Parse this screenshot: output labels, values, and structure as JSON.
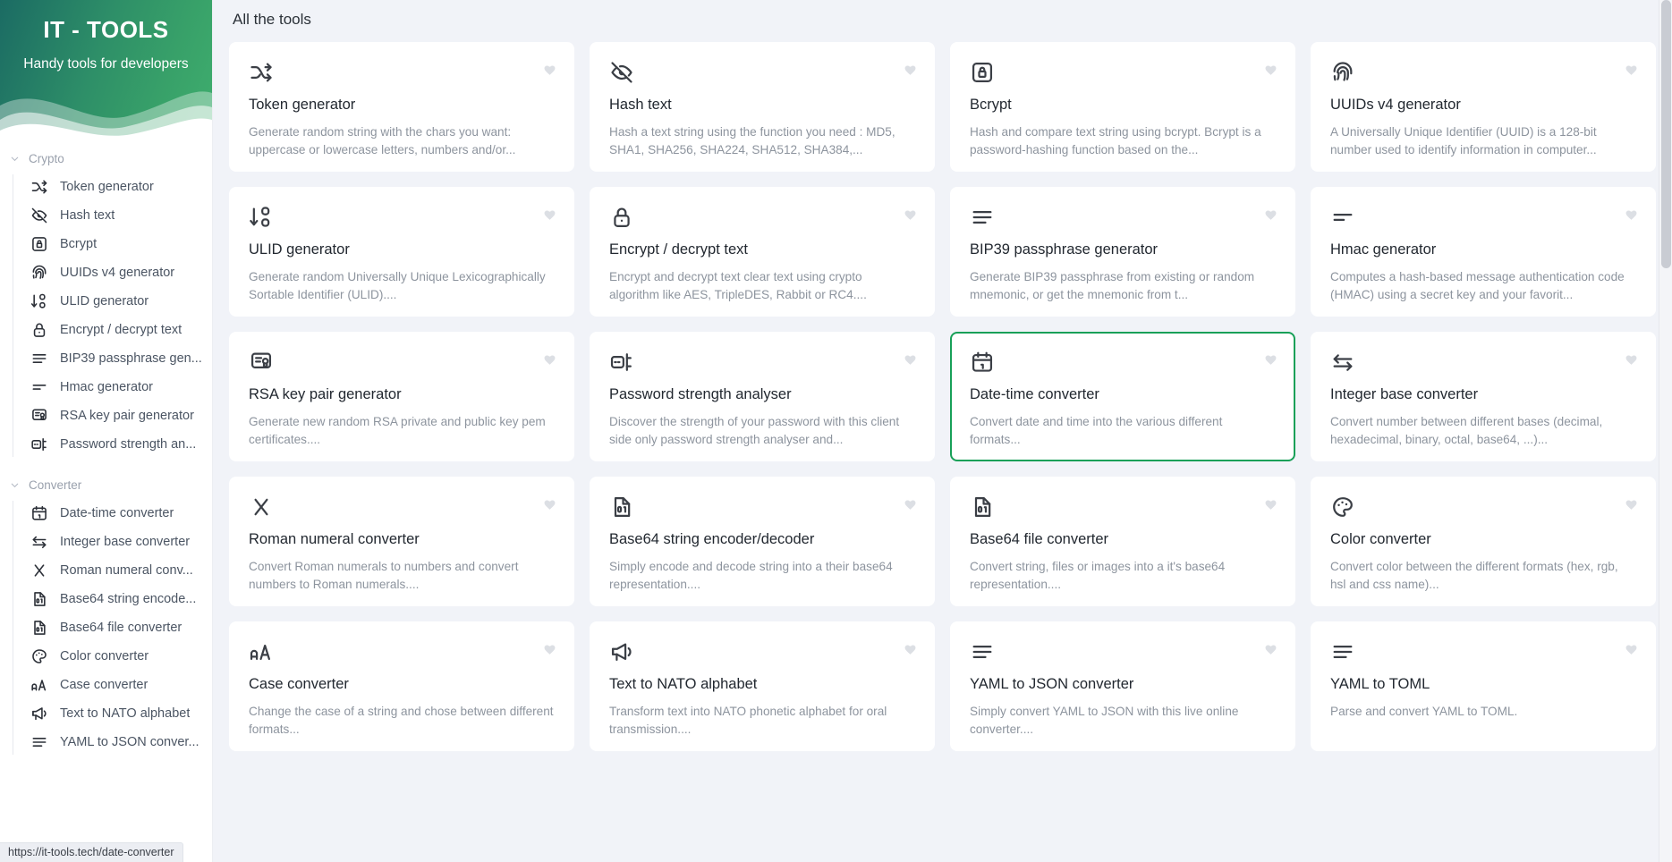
{
  "brand": {
    "title": "IT - TOOLS",
    "subtitle": "Handy tools for developers"
  },
  "sidebar": {
    "groups": [
      {
        "label": "Crypto",
        "icon": "chevron-down-icon",
        "items": [
          {
            "label": "Token generator",
            "icon": "shuffle-icon"
          },
          {
            "label": "Hash text",
            "icon": "eye-off-icon"
          },
          {
            "label": "Bcrypt",
            "icon": "lock-square-icon"
          },
          {
            "label": "UUIDs v4 generator",
            "icon": "fingerprint-icon"
          },
          {
            "label": "ULID generator",
            "icon": "sort-numeric-icon"
          },
          {
            "label": "Encrypt / decrypt text",
            "icon": "padlock-icon"
          },
          {
            "label": "BIP39 passphrase gen...",
            "icon": "list-lines-icon"
          },
          {
            "label": "Hmac generator",
            "icon": "short-lines-icon"
          },
          {
            "label": "RSA key pair generator",
            "icon": "certificate-icon"
          },
          {
            "label": "Password strength an...",
            "icon": "password-meter-icon"
          }
        ]
      },
      {
        "label": "Converter",
        "icon": "chevron-down-icon",
        "items": [
          {
            "label": "Date-time converter",
            "icon": "calendar-icon"
          },
          {
            "label": "Integer base converter",
            "icon": "arrows-exchange-icon"
          },
          {
            "label": "Roman numeral conv...",
            "icon": "letter-x-icon"
          },
          {
            "label": "Base64 string encode...",
            "icon": "file-binary-icon"
          },
          {
            "label": "Base64 file converter",
            "icon": "file-binary-icon"
          },
          {
            "label": "Color converter",
            "icon": "palette-icon"
          },
          {
            "label": "Case converter",
            "icon": "letter-case-icon"
          },
          {
            "label": "Text to NATO alphabet",
            "icon": "megaphone-icon"
          },
          {
            "label": "YAML to JSON conver...",
            "icon": "list-lines-icon"
          }
        ]
      }
    ]
  },
  "main": {
    "title": "All the tools",
    "cards": [
      {
        "title": "Token generator",
        "desc": "Generate random string with the chars you want: uppercase or lowercase letters, numbers and/or...",
        "icon": "shuffle-icon",
        "selected": false
      },
      {
        "title": "Hash text",
        "desc": "Hash a text string using the function you need : MD5, SHA1, SHA256, SHA224, SHA512, SHA384,...",
        "icon": "eye-off-icon",
        "selected": false
      },
      {
        "title": "Bcrypt",
        "desc": "Hash and compare text string using bcrypt. Bcrypt is a password-hashing function based on the...",
        "icon": "lock-square-icon",
        "selected": false
      },
      {
        "title": "UUIDs v4 generator",
        "desc": "A Universally Unique Identifier (UUID) is a 128-bit number used to identify information in computer...",
        "icon": "fingerprint-icon",
        "selected": false
      },
      {
        "title": "ULID generator",
        "desc": "Generate random Universally Unique Lexicographically Sortable Identifier (ULID)....",
        "icon": "sort-numeric-icon",
        "selected": false
      },
      {
        "title": "Encrypt / decrypt text",
        "desc": "Encrypt and decrypt text clear text using crypto algorithm like AES, TripleDES, Rabbit or RC4....",
        "icon": "padlock-icon",
        "selected": false
      },
      {
        "title": "BIP39 passphrase generator",
        "desc": "Generate BIP39 passphrase from existing or random mnemonic, or get the mnemonic from t...",
        "icon": "list-lines-icon",
        "selected": false
      },
      {
        "title": "Hmac generator",
        "desc": "Computes a hash-based message authentication code (HMAC) using a secret key and your favorit...",
        "icon": "short-lines-icon",
        "selected": false
      },
      {
        "title": "RSA key pair generator",
        "desc": "Generate new random RSA private and public key pem certificates....",
        "icon": "certificate-icon",
        "selected": false
      },
      {
        "title": "Password strength analyser",
        "desc": "Discover the strength of your password with this client side only password strength analyser and...",
        "icon": "password-meter-icon",
        "selected": false
      },
      {
        "title": "Date-time converter",
        "desc": "Convert date and time into the various different formats...",
        "icon": "calendar-icon",
        "selected": true
      },
      {
        "title": "Integer base converter",
        "desc": "Convert number between different bases (decimal, hexadecimal, binary, octal, base64, ...)...",
        "icon": "arrows-exchange-icon",
        "selected": false
      },
      {
        "title": "Roman numeral converter",
        "desc": "Convert Roman numerals to numbers and convert numbers to Roman numerals....",
        "icon": "letter-x-icon",
        "selected": false
      },
      {
        "title": "Base64 string encoder/decoder",
        "desc": "Simply encode and decode string into a their base64 representation....",
        "icon": "file-binary-icon",
        "selected": false
      },
      {
        "title": "Base64 file converter",
        "desc": "Convert string, files or images into a it's base64 representation....",
        "icon": "file-binary-icon",
        "selected": false
      },
      {
        "title": "Color converter",
        "desc": "Convert color between the different formats (hex, rgb, hsl and css name)...",
        "icon": "palette-icon",
        "selected": false
      },
      {
        "title": "Case converter",
        "desc": "Change the case of a string and chose between different formats...",
        "icon": "letter-case-icon",
        "selected": false
      },
      {
        "title": "Text to NATO alphabet",
        "desc": "Transform text into NATO phonetic alphabet for oral transmission....",
        "icon": "megaphone-icon",
        "selected": false
      },
      {
        "title": "YAML to JSON converter",
        "desc": "Simply convert YAML to JSON with this live online converter....",
        "icon": "list-lines-icon",
        "selected": false
      },
      {
        "title": "YAML to TOML",
        "desc": "Parse and convert YAML to TOML.",
        "icon": "list-lines-icon",
        "selected": false
      }
    ]
  },
  "statusbar": {
    "url": "https://it-tools.tech/date-converter"
  },
  "colors": {
    "accent": "#18a058",
    "brand_gradient_start": "#1b6b63",
    "brand_gradient_end": "#3fae6e",
    "page_bg": "#f1f3f8",
    "card_bg": "#ffffff",
    "favorite_icon": "#dcdfe4"
  }
}
